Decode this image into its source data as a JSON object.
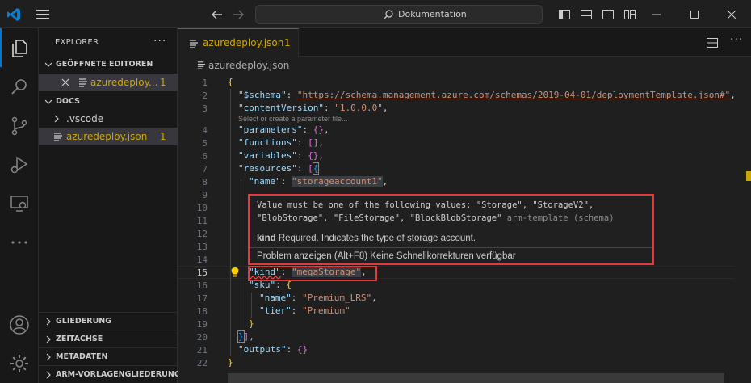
{
  "titlebar": {
    "search_text": "Dokumentation"
  },
  "sidebar": {
    "title": "EXPLORER",
    "more": "···",
    "open_editors_label": "GEÖFFNETE EDITOREN",
    "open_editor_file": "azuredeploy...",
    "open_editor_count": "1",
    "folder_label": "DOCS",
    "vscode_folder": ".vscode",
    "file_name": "azuredeploy.json",
    "file_count": "1",
    "outline_label": "GLIEDERUNG",
    "timeline_label": "ZEITACHSE",
    "metadata_label": "METADATEN",
    "arm_label": "ARM-VORLAGENGLIEDERUNG"
  },
  "tab": {
    "name": "azuredeploy.json",
    "count": "1",
    "more": "···"
  },
  "breadcrumb": {
    "file": "azuredeploy.json"
  },
  "code": {
    "line_numbers": [
      "1",
      "2",
      "3",
      "4",
      "5",
      "6",
      "7",
      "8",
      "9",
      "10",
      "11",
      "12",
      "13",
      "14",
      "15",
      "16",
      "17",
      "18",
      "19",
      "20",
      "21",
      "22"
    ],
    "schema_key": "\"$schema\"",
    "schema_val": "\"https://schema.management.azure.com/schemas/2019-04-01/deploymentTemplate.json#\"",
    "cv_key": "\"contentVersion\"",
    "cv_val": "\"1.0.0.0\"",
    "param_hint": "Select or create a parameter file...",
    "parameters_key": "\"parameters\"",
    "functions_key": "\"functions\"",
    "variables_key": "\"variables\"",
    "resources_key": "\"resources\"",
    "name_key": "\"name\"",
    "name_val": "\"storageaccount1\"",
    "kind_key": "\"kind\"",
    "kind_val": "\"megaStorage\"",
    "sku_key": "\"sku\"",
    "sku_name_key": "\"name\"",
    "sku_name_val": "\"Premium_LRS\"",
    "tier_key": "\"tier\"",
    "tier_val": "\"Premium\"",
    "outputs_key": "\"outputs\""
  },
  "hover": {
    "line1": "Value must be one of the following values: \"Storage\", \"StorageV2\",",
    "line2_main": "\"BlobStorage\", \"FileStorage\", \"BlockBlobStorage\"",
    "line2_muted": "arm-template (schema)",
    "kind_bold": "kind",
    "kind_desc": "Required. Indicates the type of storage account.",
    "action": "Problem anzeigen (Alt+F8) Keine Schnellkorrekturen verfügbar"
  },
  "colors": {
    "accent": "#0078d4",
    "warning": "#cca700",
    "error_box": "#e5393b"
  }
}
